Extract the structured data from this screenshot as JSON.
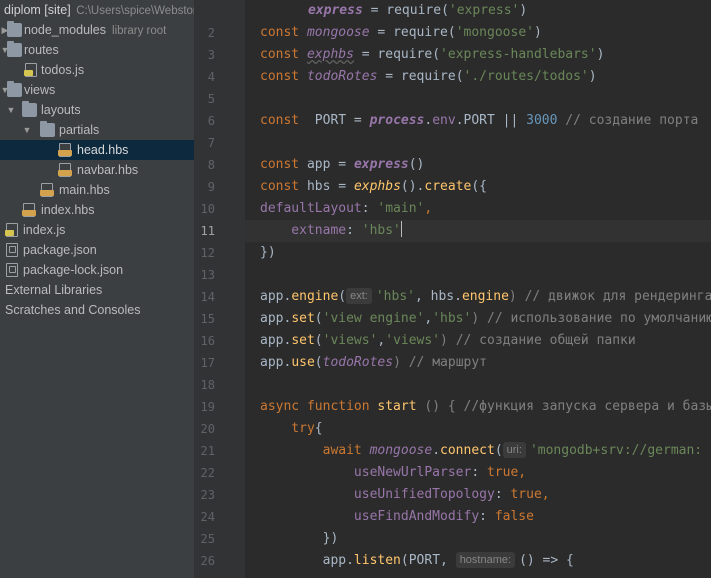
{
  "project_tree": {
    "root": {
      "name": "diplom [site]",
      "path": "C:\\Users\\spice\\WebstormProjects\\diplom"
    },
    "items": [
      {
        "label": "node_modules",
        "hint": "library root",
        "icon": "folder-icon"
      },
      {
        "label": "routes",
        "hint": "",
        "icon": "folder-icon"
      },
      {
        "label": "todos.js",
        "hint": "",
        "icon": "js-file-icon"
      },
      {
        "label": "views",
        "hint": "",
        "icon": "folder-icon"
      },
      {
        "label": "layouts",
        "hint": "",
        "icon": "folder-icon"
      },
      {
        "label": "partials",
        "hint": "",
        "icon": "folder-icon"
      },
      {
        "label": "head.hbs",
        "hint": "",
        "icon": "hbs-file-icon"
      },
      {
        "label": "navbar.hbs",
        "hint": "",
        "icon": "hbs-file-icon"
      },
      {
        "label": "main.hbs",
        "hint": "",
        "icon": "hbs-file-icon"
      },
      {
        "label": "index.hbs",
        "hint": "",
        "icon": "hbs-file-icon"
      },
      {
        "label": "index.js",
        "hint": "",
        "icon": "js-file-icon"
      },
      {
        "label": "package.json",
        "hint": "",
        "icon": "json-file-icon"
      },
      {
        "label": "package-lock.json",
        "hint": "",
        "icon": "json-file-icon"
      },
      {
        "label": "External Libraries",
        "hint": "",
        "icon": "library-icon"
      },
      {
        "label": "Scratches and Consoles",
        "hint": "",
        "icon": "scratches-icon"
      }
    ]
  },
  "editor": {
    "current_line": "11",
    "line_numbers": [
      "2",
      "3",
      "4",
      "5",
      "6",
      "7",
      "8",
      "9",
      "10",
      "11",
      "12",
      "13",
      "14",
      "15",
      "16",
      "17",
      "18",
      "19",
      "20",
      "21",
      "22",
      "23",
      "24",
      "25",
      "26"
    ],
    "line1": {
      "t1": "express",
      "t2": " = ",
      "t3": "require",
      "t4": "(",
      "t5": "'express'",
      "t6": ")"
    },
    "line2": {
      "t1": "const ",
      "t2": "mongoose",
      "t3": " = ",
      "t4": "require",
      "t5": "(",
      "t6": "'mongoose'",
      "t7": ")"
    },
    "line3": {
      "t1": "const ",
      "t2": "exphbs",
      "t3": " = ",
      "t4": "require",
      "t5": "(",
      "t6": "'express-handlebars'",
      "t7": ")"
    },
    "line4": {
      "t1": "const ",
      "t2": "todoRotes",
      "t3": " = ",
      "t4": "require",
      "t5": "(",
      "t6": "'./routes/todos'",
      "t7": ")"
    },
    "line6": {
      "t1": "const  ",
      "t2": "PORT = ",
      "t3": "process",
      "t4": ".",
      "t5": "env",
      "t6": ".PORT || ",
      "t7": "3000",
      "t8": " // создание порта"
    },
    "line8": {
      "t1": "const ",
      "t2": "app = ",
      "t3": "express",
      "t4": "()"
    },
    "line9": {
      "t1": "const ",
      "t2": "hbs = ",
      "t3": "exphbs",
      "t4": "().",
      "t5": "create",
      "t6": "({"
    },
    "line10": {
      "t1": "defaultLayout",
      "t2": ": ",
      "t3": "'main'",
      "t4": ","
    },
    "line11": {
      "t1": "    extname",
      "t2": ": ",
      "t3": "'hbs'"
    },
    "line12": {
      "t1": "})"
    },
    "line14": {
      "t1": "app.",
      "t2": "engine",
      "t3": "(",
      "chip": "ext:",
      "t4": "'hbs'",
      "t5": ", hbs.",
      "t6": "engine",
      "t7": ") // движок для рендеринга"
    },
    "line15": {
      "t1": "app.",
      "t2": "set",
      "t3": "(",
      "t4": "'view engine'",
      "t5": ",",
      "t6": "'hbs'",
      "t7": ") // использование по умолчанию"
    },
    "line16": {
      "t1": "app.",
      "t2": "set",
      "t3": "(",
      "t4": "'views'",
      "t5": ",",
      "t6": "'views'",
      "t7": ") // создание общей папки"
    },
    "line17": {
      "t1": "app.",
      "t2": "use",
      "t3": "(",
      "t4": "todoRotes",
      "t5": ") // маршрут"
    },
    "line19": {
      "t1": "async function ",
      "t2": "start",
      "t3": " () { //функция запуска сервера и базы"
    },
    "line20": {
      "t1": "    try",
      "t2": "{"
    },
    "line21": {
      "t1": "        await ",
      "t2": "mongoose",
      "t3": ".",
      "t4": "connect",
      "t5": "(",
      "chip": "uri:",
      "t6": "'mongodb+srv://german:"
    },
    "line22": {
      "t1": "            useNewUrlParser",
      "t2": ": ",
      "t3": "true",
      "t4": ","
    },
    "line23": {
      "t1": "            useUnifiedTopology",
      "t2": ": ",
      "t3": "true",
      "t4": ","
    },
    "line24": {
      "t1": "            useFindAndModify",
      "t2": ": ",
      "t3": "false"
    },
    "line25": {
      "t1": "        })"
    },
    "line26": {
      "t1": "        app.",
      "t2": "listen",
      "t3": "(PORT, ",
      "chip": "hostname:",
      "t4": "() => {"
    }
  },
  "colors": {
    "background": "#2b2b2b",
    "sidebar": "#3c3f41",
    "selection": "#0d293e",
    "keyword": "#cc7832",
    "string": "#6a8759",
    "number": "#6897bb",
    "comment": "#808080",
    "function": "#ffc66d",
    "member": "#9876aa"
  }
}
